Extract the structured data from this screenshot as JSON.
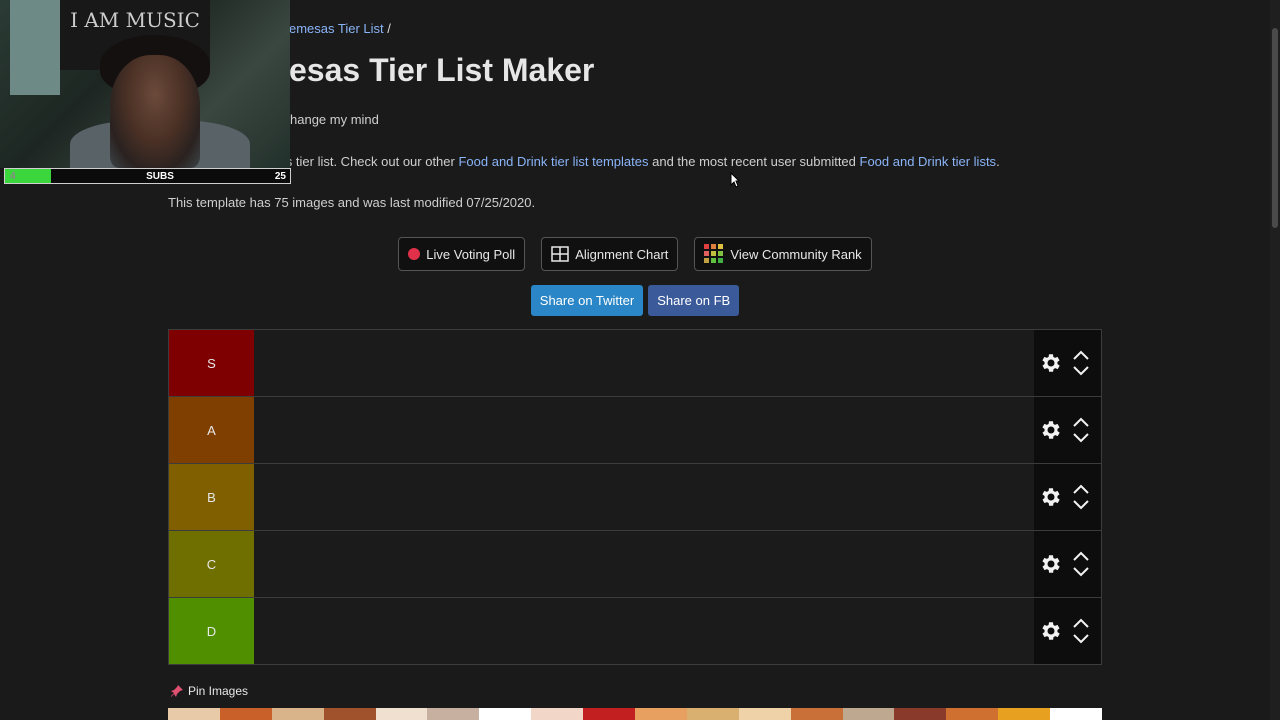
{
  "breadcrumb": {
    "link": "emesas Tier List",
    "separator": "/"
  },
  "title": "esas Tier List Maker",
  "subtitle": "hange my mind",
  "description": {
    "prefix": "Create a sopremesas tier list. Check out our other ",
    "link1": "Food and Drink tier list templates",
    "middle": " and the most recent user submitted ",
    "link2": "Food and Drink tier lists",
    "suffix": "."
  },
  "meta": "This template has 75 images and was last modified 07/25/2020.",
  "buttons": {
    "live_voting": "Live Voting Poll",
    "alignment": "Alignment Chart",
    "community": "View Community Rank",
    "share_twitter": "Share on Twitter",
    "share_fb": "Share on FB"
  },
  "tiers": [
    {
      "label": "S",
      "color": "#7f0000"
    },
    {
      "label": "A",
      "color": "#7f3f00"
    },
    {
      "label": "B",
      "color": "#7f5f00"
    },
    {
      "label": "C",
      "color": "#6f6f00"
    },
    {
      "label": "D",
      "color": "#4f8f00"
    }
  ],
  "pin_label": "Pin Images",
  "overlay": {
    "poster_text": "I AM MUSIC",
    "subs_current": "4",
    "subs_label": "SUBS",
    "subs_goal": "25",
    "subs_progress": 0.16
  },
  "image_strip_colors": [
    "#e8c9a8",
    "#c9602a",
    "#d9b48a",
    "#a0522d",
    "#efe0d0",
    "#c8b0a0",
    "#ffffff",
    "#f2d6c8",
    "#c22020",
    "#e8a060",
    "#d9b070",
    "#efd2a8",
    "#c87038",
    "#bfa890",
    "#8a3a2a",
    "#d07030",
    "#e8a020",
    "#ffffff"
  ]
}
